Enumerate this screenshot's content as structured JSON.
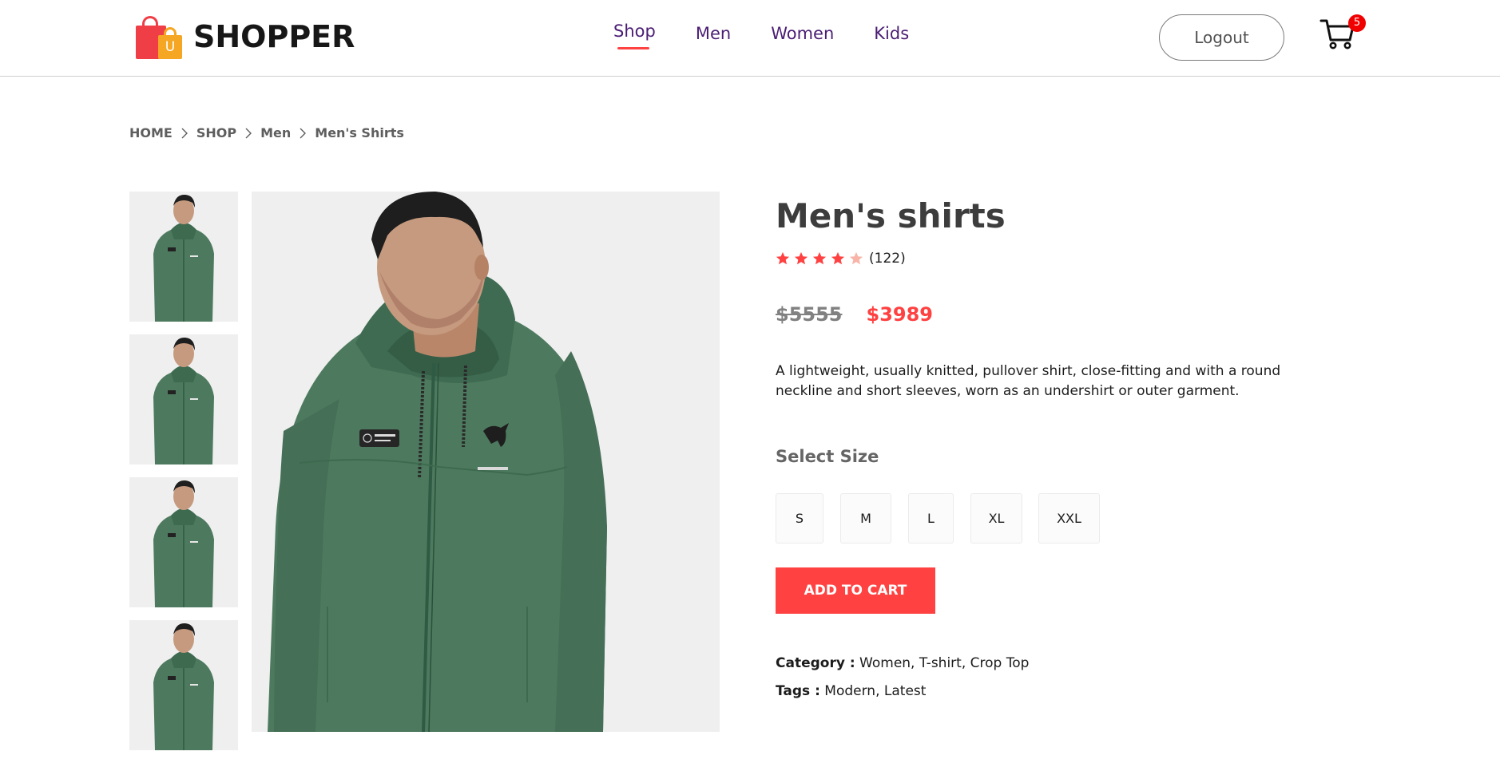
{
  "navbar": {
    "logo_text": "SHOPPER",
    "logo_bag_letter": "U",
    "menu": [
      {
        "label": "Shop",
        "active": true
      },
      {
        "label": "Men",
        "active": false
      },
      {
        "label": "Women",
        "active": false
      },
      {
        "label": "Kids",
        "active": false
      }
    ],
    "logout_label": "Logout",
    "cart_count": "5"
  },
  "breadcrumb": [
    "HOME",
    "SHOP",
    "Men",
    "Men's Shirts"
  ],
  "product": {
    "title": "Men's shirts",
    "rating": 4,
    "rating_max": 5,
    "review_count": "(122)",
    "old_price": "$5555",
    "new_price": "$3989",
    "description": "A lightweight, usually knitted, pullover shirt, close-fitting and with a round neckline and short sleeves, worn as an undershirt or outer garment.",
    "size_title": "Select Size",
    "sizes": [
      "S",
      "M",
      "L",
      "XL",
      "XXL"
    ],
    "add_to_cart_label": "ADD TO CART",
    "category_label": "Category :",
    "category_value": "Women, T-shirt, Crop Top",
    "tags_label": "Tags :",
    "tags_value": "Modern, Latest"
  },
  "colors": {
    "accent_red": "#ff4141",
    "nav_purple": "#4a1d74",
    "jacket_green": "#4d7a5e",
    "star_filled": "#ff4141",
    "star_empty": "#f8b4a8"
  }
}
